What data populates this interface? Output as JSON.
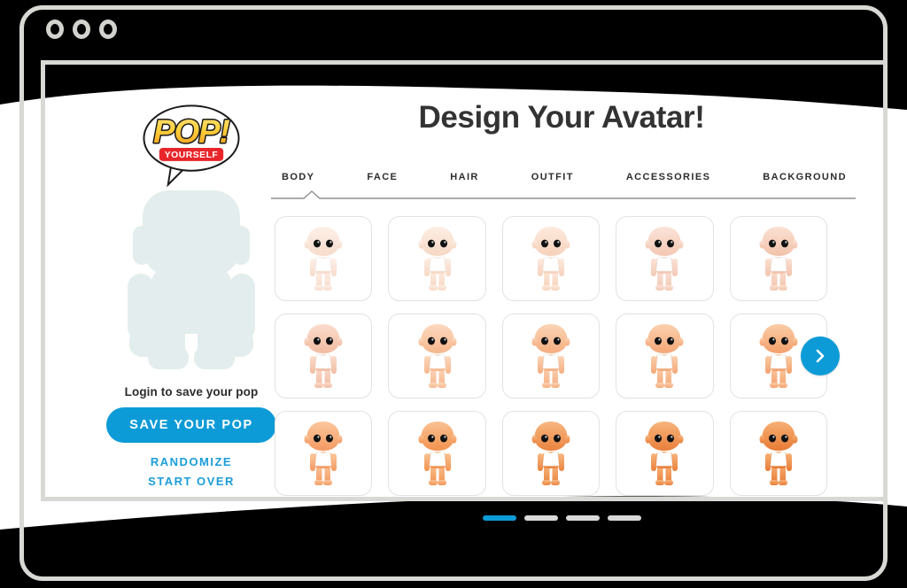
{
  "window": {
    "dots": [
      "window-dot-1",
      "window-dot-2",
      "window-dot-3"
    ]
  },
  "brand": {
    "logo_pop": "POP!",
    "logo_yourself": "YOURSELF",
    "logo_alt": "pop-yourself-logo"
  },
  "header": {
    "title": "Design Your Avatar!"
  },
  "tabs": [
    {
      "label": "BODY",
      "active": true
    },
    {
      "label": "FACE",
      "active": false
    },
    {
      "label": "HAIR",
      "active": false
    },
    {
      "label": "OUTFIT",
      "active": false
    },
    {
      "label": "ACCESSORIES",
      "active": false
    },
    {
      "label": "BACKGROUND",
      "active": false
    }
  ],
  "preview": {
    "silhouette_alt": "avatar-silhouette-placeholder",
    "silhouette_color": "#e3ecec"
  },
  "sidebar": {
    "login_prompt": "Login to save your pop",
    "save_label": "SAVE YOUR POP",
    "randomize_label": "RANDOMIZE",
    "start_over_label": "START OVER"
  },
  "carousel": {
    "next_label": "›",
    "next_aria": "next-page",
    "pages": 4,
    "current_page": 1
  },
  "options": {
    "rows": 3,
    "columns": 5,
    "count": 15,
    "items": [
      {
        "id": "body-1",
        "skin_top": "#fdf0e7",
        "skin_bottom": "#f7dccc"
      },
      {
        "id": "body-2",
        "skin_top": "#fdeee3",
        "skin_bottom": "#f6d8c4"
      },
      {
        "id": "body-3",
        "skin_top": "#fdeade",
        "skin_bottom": "#f6d2bb"
      },
      {
        "id": "body-4",
        "skin_top": "#fbe3d8",
        "skin_bottom": "#f3c8b4"
      },
      {
        "id": "body-5",
        "skin_top": "#fbe0d2",
        "skin_bottom": "#f2c3ac"
      },
      {
        "id": "body-6",
        "skin_top": "#fbdccc",
        "skin_bottom": "#f1bca2"
      },
      {
        "id": "body-7",
        "skin_top": "#fcd9bf",
        "skin_bottom": "#f6b78d"
      },
      {
        "id": "body-8",
        "skin_top": "#fbd4b6",
        "skin_bottom": "#f5ae80"
      },
      {
        "id": "body-9",
        "skin_top": "#fbd0ae",
        "skin_bottom": "#f4a877"
      },
      {
        "id": "body-10",
        "skin_top": "#facca6",
        "skin_bottom": "#f3a06c"
      },
      {
        "id": "body-11",
        "skin_top": "#fbc89d",
        "skin_bottom": "#f49a62"
      },
      {
        "id": "body-12",
        "skin_top": "#fac294",
        "skin_bottom": "#f2934f"
      },
      {
        "id": "body-13",
        "skin_top": "#f8b881",
        "skin_bottom": "#ea8440"
      },
      {
        "id": "body-14",
        "skin_top": "#f8b57c",
        "skin_bottom": "#e9803b"
      },
      {
        "id": "body-15",
        "skin_top": "#f7b074",
        "skin_bottom": "#e77b35"
      }
    ]
  },
  "colors": {
    "accent_blue": "#0d9bd7",
    "link_blue": "#1b9dd9",
    "text_dark": "#2d2d2d",
    "frame_gray": "#d8d8d4",
    "card_border": "#e2e2e2",
    "logo_red": "#e8252a",
    "logo_yellow": "#ffd23f",
    "logo_orange": "#f6a01e"
  }
}
